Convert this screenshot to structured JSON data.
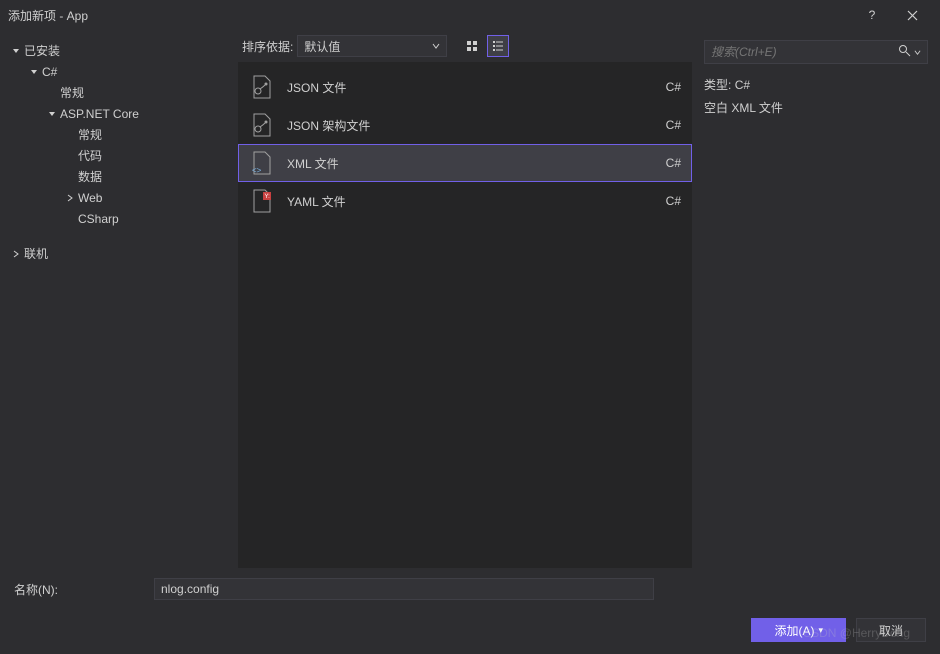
{
  "window": {
    "title": "添加新项 - App"
  },
  "sidebar": {
    "items": [
      {
        "label": "已安装",
        "level": 0,
        "arrow": "down"
      },
      {
        "label": "C#",
        "level": 1,
        "arrow": "down"
      },
      {
        "label": "常规",
        "level": 2,
        "arrow": "none"
      },
      {
        "label": "ASP.NET Core",
        "level": 2,
        "arrow": "down"
      },
      {
        "label": "常规",
        "level": 3,
        "arrow": "none"
      },
      {
        "label": "代码",
        "level": 3,
        "arrow": "none"
      },
      {
        "label": "数据",
        "level": 3,
        "arrow": "none"
      },
      {
        "label": "Web",
        "level": 3,
        "arrow": "right"
      },
      {
        "label": "CSharp",
        "level": 3,
        "arrow": "none"
      },
      {
        "label": "联机",
        "level": 0,
        "arrow": "right"
      }
    ]
  },
  "toolbar": {
    "sort_label": "排序依据:",
    "sort_value": "默认值"
  },
  "search": {
    "placeholder": "搜索(Ctrl+E)"
  },
  "items": [
    {
      "label": "JSON 文件",
      "lang": "C#",
      "icon": "json",
      "selected": false
    },
    {
      "label": "JSON 架构文件",
      "lang": "C#",
      "icon": "json",
      "selected": false
    },
    {
      "label": "XML 文件",
      "lang": "C#",
      "icon": "xml",
      "selected": true
    },
    {
      "label": "YAML 文件",
      "lang": "C#",
      "icon": "yaml",
      "selected": false
    }
  ],
  "details": {
    "type_label": "类型:",
    "type_value": "C#",
    "description": "空白 XML 文件"
  },
  "footer": {
    "name_label": "名称(N):",
    "name_value": "nlog.config",
    "add_label": "添加(A)",
    "cancel_label": "取消"
  },
  "watermark": "CSDN @HerryDong"
}
